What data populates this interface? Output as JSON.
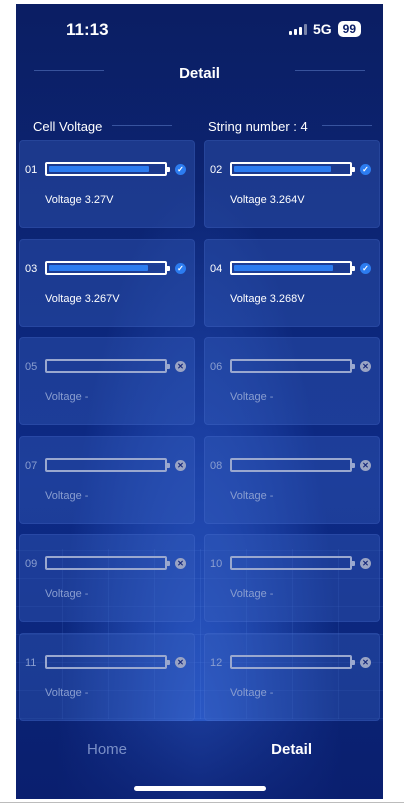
{
  "status_bar": {
    "time": "11:13",
    "network": "5G",
    "battery": "99"
  },
  "nav": {
    "title": "Detail"
  },
  "section": {
    "left_label": "Cell Voltage",
    "right_label": "String number : 4"
  },
  "cells": [
    {
      "num": "01",
      "voltage_text": "Voltage  3.27V",
      "level": 0.88,
      "active": true,
      "state_icon": "check-icon"
    },
    {
      "num": "02",
      "voltage_text": "Voltage  3.264V",
      "level": 0.86,
      "active": true,
      "state_icon": "check-icon"
    },
    {
      "num": "03",
      "voltage_text": "Voltage  3.267V",
      "level": 0.87,
      "active": true,
      "state_icon": "check-icon"
    },
    {
      "num": "04",
      "voltage_text": "Voltage  3.268V",
      "level": 0.87,
      "active": true,
      "state_icon": "check-icon"
    },
    {
      "num": "05",
      "voltage_text": "Voltage  -",
      "level": 0,
      "active": false,
      "state_icon": "close-icon"
    },
    {
      "num": "06",
      "voltage_text": "Voltage  -",
      "level": 0,
      "active": false,
      "state_icon": "close-icon"
    },
    {
      "num": "07",
      "voltage_text": "Voltage  -",
      "level": 0,
      "active": false,
      "state_icon": "close-icon"
    },
    {
      "num": "08",
      "voltage_text": "Voltage  -",
      "level": 0,
      "active": false,
      "state_icon": "close-icon"
    },
    {
      "num": "09",
      "voltage_text": "Voltage  -",
      "level": 0,
      "active": false,
      "state_icon": "close-icon"
    },
    {
      "num": "10",
      "voltage_text": "Voltage  -",
      "level": 0,
      "active": false,
      "state_icon": "close-icon"
    },
    {
      "num": "11",
      "voltage_text": "Voltage  -",
      "level": 0,
      "active": false,
      "state_icon": "close-icon"
    },
    {
      "num": "12",
      "voltage_text": "Voltage  -",
      "level": 0,
      "active": false,
      "state_icon": "close-icon"
    }
  ],
  "tabs": [
    {
      "label": "Home",
      "selected": false
    },
    {
      "label": "Detail",
      "selected": true
    }
  ],
  "colors": {
    "accent": "#2c7cf0",
    "background": "#0c2678",
    "inactive_text": "#7a8fc7"
  }
}
